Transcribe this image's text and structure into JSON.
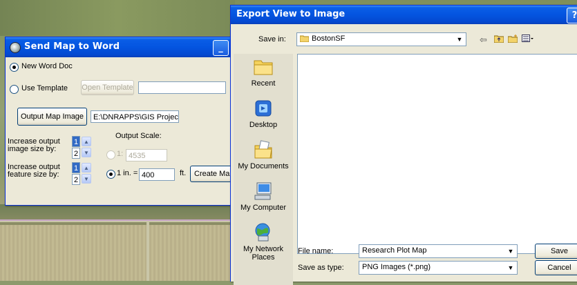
{
  "send_map_dialog": {
    "title": "Send Map to Word",
    "minimize_glyph": "_",
    "new_word_doc_label": "New Word Doc",
    "use_template_label": "Use Template",
    "open_template_label": "Open Template",
    "template_path_value": "",
    "output_map_image_label": "Output Map Image",
    "output_path_value": "E:\\DNRAPPS\\GIS Project",
    "increase_image_label_line1": "Increase output",
    "increase_image_label_line2": "image size by:",
    "increase_feature_label_line1": "Increase output",
    "increase_feature_label_line2": "feature size by:",
    "image_spin_values": [
      "1",
      "2"
    ],
    "feature_spin_values": [
      "1",
      "2"
    ],
    "output_scale_label": "Output Scale:",
    "scale_ratio_prefix": "1:",
    "scale_ratio_value": "4535",
    "scale_inch_prefix": "1 in. =",
    "scale_inch_value": "400",
    "scale_inch_unit": "ft.",
    "create_map_label": "Create Map"
  },
  "export_dialog": {
    "title": "Export View to Image",
    "help_glyph": "?",
    "save_in_label": "Save in:",
    "save_in_value": "BostonSF",
    "places": [
      {
        "label": "Recent",
        "icon": "recent-folder-icon"
      },
      {
        "label": "Desktop",
        "icon": "desktop-icon"
      },
      {
        "label": "My Documents",
        "icon": "my-documents-icon"
      },
      {
        "label": "My Computer",
        "icon": "my-computer-icon"
      },
      {
        "label": "My Network Places",
        "icon": "network-places-icon"
      }
    ],
    "file_name_label": "File name:",
    "file_name_value": "Research Plot Map",
    "save_as_type_label": "Save as type:",
    "save_as_type_value": "PNG Images (*.png)",
    "save_label": "Save",
    "cancel_label": "Cancel"
  }
}
